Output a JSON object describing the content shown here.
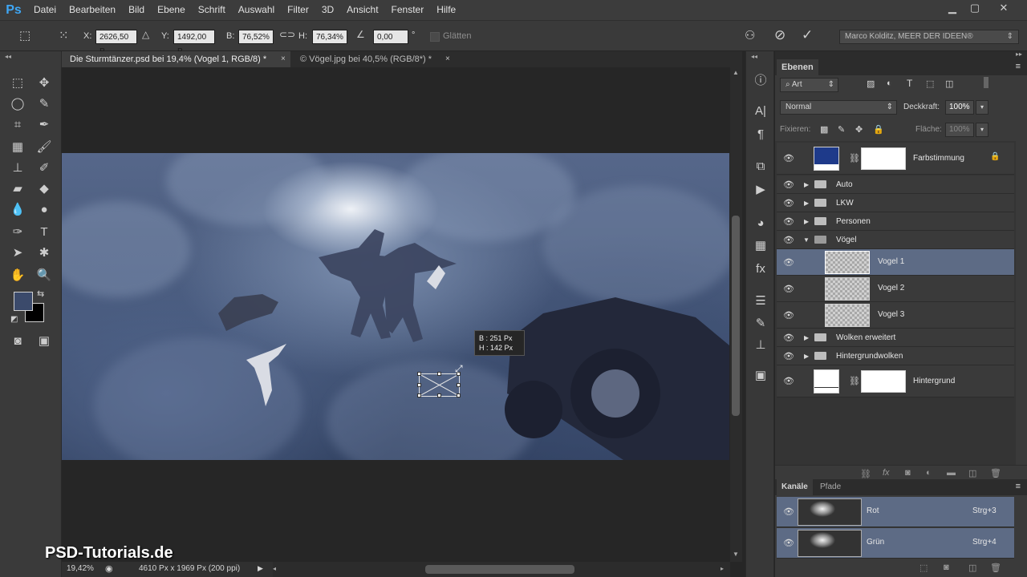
{
  "menu": {
    "logo": "Ps",
    "items": [
      "Datei",
      "Bearbeiten",
      "Bild",
      "Ebene",
      "Schrift",
      "Auswahl",
      "Filter",
      "3D",
      "Ansicht",
      "Fenster",
      "Hilfe"
    ]
  },
  "options": {
    "x_label": "X:",
    "x_value": "2626,50 P.",
    "y_label": "Y:",
    "y_value": "1492,00 P.",
    "w_label": "B:",
    "w_value": "76,52%",
    "h_label": "H:",
    "h_value": "76,34%",
    "angle_value": "0,00",
    "angle_unit": "°",
    "smooth_label": "Glätten",
    "workspace": "Marco Kolditz, MEER DER IDEEN®"
  },
  "tabs": [
    {
      "title": "Die Sturmtänzer.psd bei 19,4% (Vogel 1, RGB/8) *",
      "close": "×"
    },
    {
      "title": "© Vögel.jpg bei 40,5% (RGB/8*) *",
      "close": "×"
    }
  ],
  "transform_tooltip": {
    "width": "B :  251 Px",
    "height": "H :  142 Px"
  },
  "status": {
    "zoom": "19,42%",
    "docsize": "4610 Px x 1969 Px (200 ppi)"
  },
  "watermark": "PSD-Tutorials.de",
  "layers_panel": {
    "tab": "Ebenen",
    "filter_kind": "Art",
    "blend_mode": "Normal",
    "opacity_label": "Deckkraft:",
    "opacity_value": "100%",
    "lock_label": "Fixieren:",
    "fill_label": "Fläche:",
    "fill_value": "100%",
    "layers": [
      {
        "name": "Farbstimmung",
        "kind": "adjustment"
      },
      {
        "name": "Auto",
        "kind": "group"
      },
      {
        "name": "LKW",
        "kind": "group"
      },
      {
        "name": "Personen",
        "kind": "group"
      },
      {
        "name": "Vögel",
        "kind": "group-open"
      },
      {
        "name": "Vogel 1",
        "kind": "smart",
        "selected": true
      },
      {
        "name": "Vogel 2",
        "kind": "smart"
      },
      {
        "name": "Vogel 3",
        "kind": "smart"
      },
      {
        "name": "Wolken erweitert",
        "kind": "group"
      },
      {
        "name": "Hintergrundwolken",
        "kind": "group"
      },
      {
        "name": "Hintergrund",
        "kind": "adjustment"
      }
    ]
  },
  "channels_panel": {
    "tabs": [
      "Kanäle",
      "Pfade"
    ],
    "channels": [
      {
        "name": "Rot",
        "shortcut": "Strg+3"
      },
      {
        "name": "Grün",
        "shortcut": "Strg+4"
      }
    ]
  },
  "colors": {
    "foreground": "#3b4a6b",
    "background": "#000000",
    "selection": "#5d6b85",
    "adjustment_swatch": "#1e3a8a"
  }
}
